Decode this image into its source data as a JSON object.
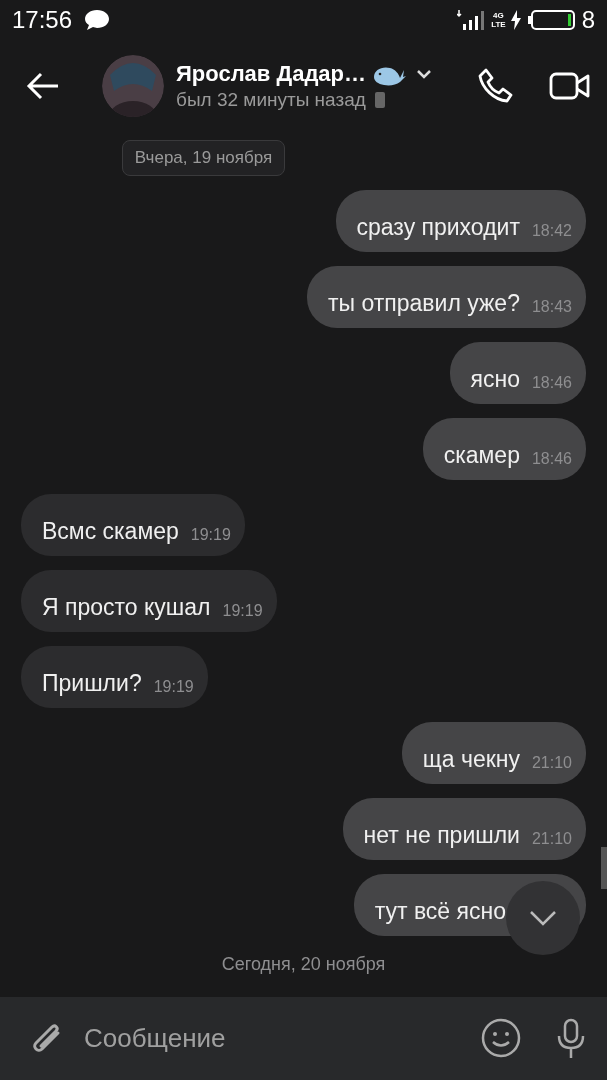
{
  "status_bar": {
    "time": "17:56",
    "network": "4G",
    "network_sub": "LTE",
    "battery": "8"
  },
  "header": {
    "name": "Ярослав Дадар…",
    "status": "был 32 минуты назад"
  },
  "date_top": "Вчера, 19 ноября",
  "messages": [
    {
      "kind": "out",
      "text": "сразу приходит",
      "time": "18:42"
    },
    {
      "kind": "out",
      "text": "ты отправил уже?",
      "time": "18:43"
    },
    {
      "kind": "out",
      "text": "ясно",
      "time": "18:46"
    },
    {
      "kind": "out",
      "text": "скамер",
      "time": "18:46"
    },
    {
      "kind": "in",
      "text": "Всмс скамер",
      "time": "19:19"
    },
    {
      "kind": "in",
      "text": "Я просто кушал",
      "time": "19:19"
    },
    {
      "kind": "in",
      "text": "Пришли?",
      "time": "19:19"
    },
    {
      "kind": "out",
      "text": "ща чекну",
      "time": "21:10"
    },
    {
      "kind": "out",
      "text": "нет не пришли",
      "time": "21:10"
    },
    {
      "kind": "out",
      "text": "тут всё ясно"
    }
  ],
  "date_bottom": "Сегодня, 20 ноября",
  "composer": {
    "placeholder": "Сообщение"
  }
}
